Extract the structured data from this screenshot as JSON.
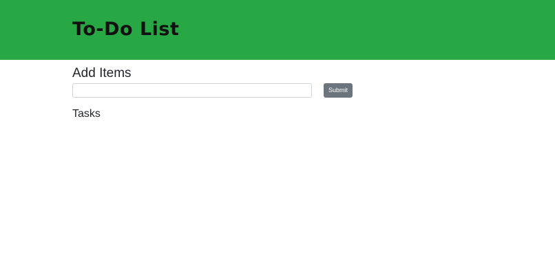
{
  "header": {
    "title": "To-Do List",
    "background_color": "#28a745"
  },
  "add_section": {
    "heading": "Add Items",
    "input_value": "",
    "input_placeholder": "",
    "submit_label": "Submit",
    "submit_color": "#6c757d"
  },
  "tasks_section": {
    "heading": "Tasks",
    "items": []
  }
}
